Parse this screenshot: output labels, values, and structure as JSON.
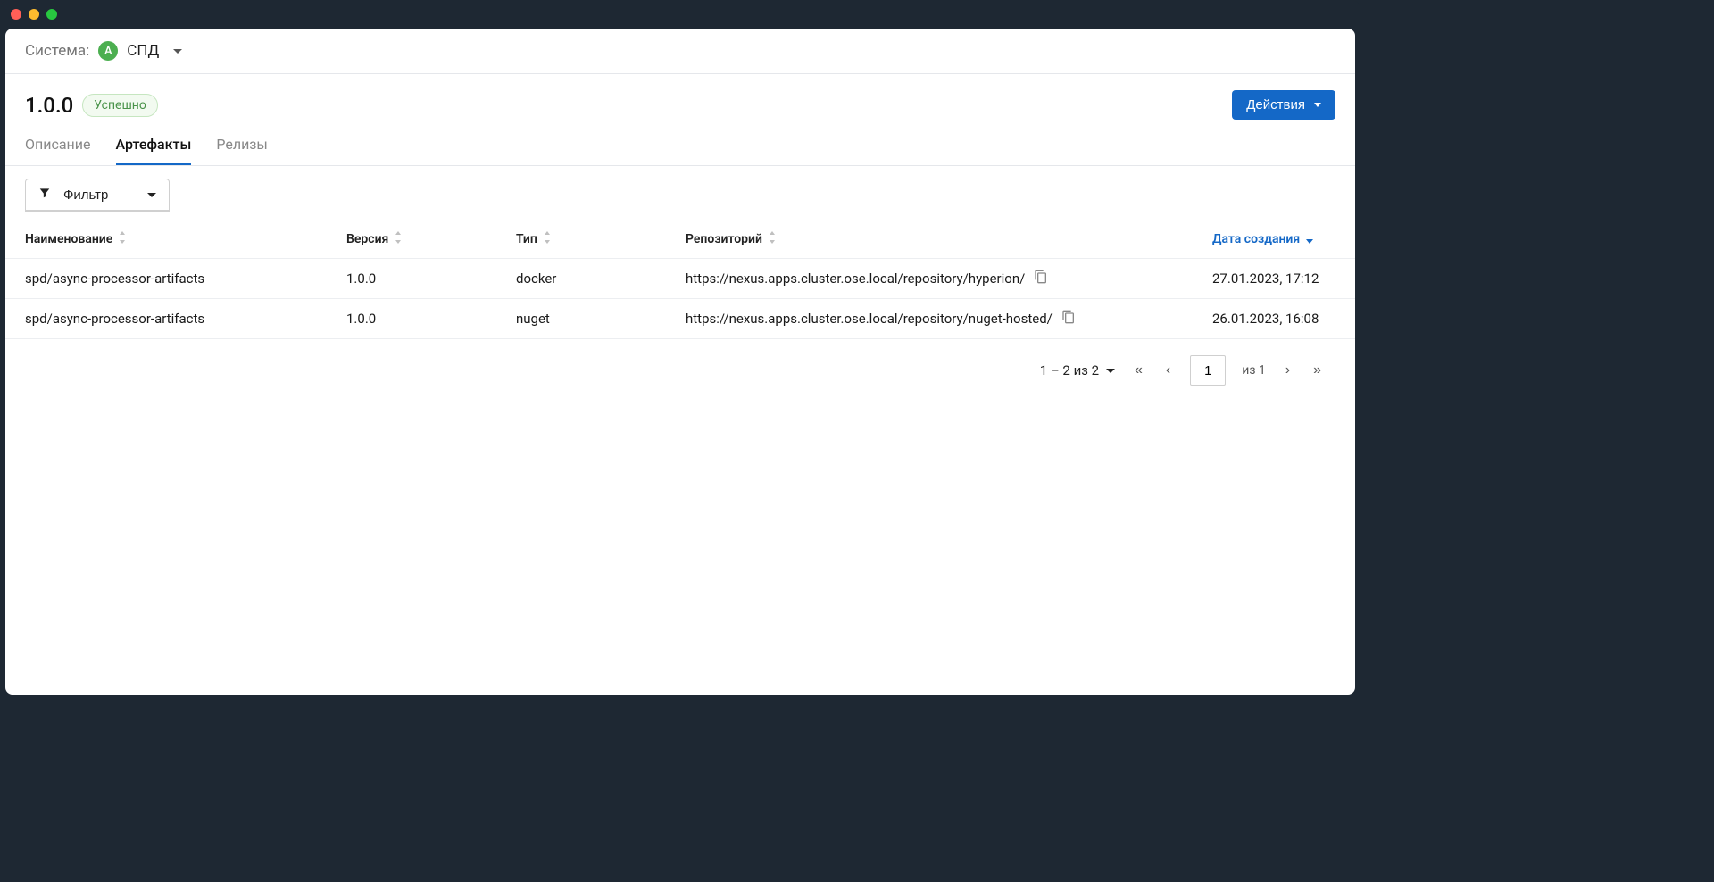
{
  "topbar": {
    "system_label": "Система:",
    "badge_letter": "А",
    "system_name": "СПД"
  },
  "header": {
    "title": "1.0.0",
    "status": "Успешно",
    "actions_label": "Действия"
  },
  "tabs": [
    {
      "label": "Описание",
      "active": false
    },
    {
      "label": "Артефакты",
      "active": true
    },
    {
      "label": "Релизы",
      "active": false
    }
  ],
  "filter_label": "Фильтр",
  "columns": {
    "name": "Наименование",
    "version": "Версия",
    "type": "Тип",
    "repo": "Репозиторий",
    "created": "Дата создания"
  },
  "rows": [
    {
      "name": "spd/async-processor-artifacts",
      "version": "1.0.0",
      "type": "docker",
      "repo": "https://nexus.apps.cluster.ose.local/repository/hyperion/",
      "created": "27.01.2023, 17:12"
    },
    {
      "name": "spd/async-processor-artifacts",
      "version": "1.0.0",
      "type": "nuget",
      "repo": "https://nexus.apps.cluster.ose.local/repository/nuget-hosted/",
      "created": "26.01.2023, 16:08"
    }
  ],
  "pagination": {
    "range": "1 – 2 из 2",
    "page": "1",
    "of_label": "из 1"
  }
}
